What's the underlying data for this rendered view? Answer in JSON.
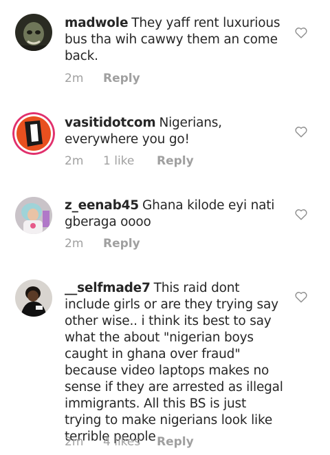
{
  "comments": [
    {
      "username": "madwole",
      "text": "They yaff rent luxurious bus tha wih cawwy them an come back.",
      "time": "2m",
      "likes": "",
      "reply": "Reply"
    },
    {
      "username": "vasitidotcom",
      "text": "Nigerians, everywhere you go!",
      "time": "2m",
      "likes": "1 like",
      "reply": "Reply"
    },
    {
      "username": "z_eenab45",
      "text": "Ghana kilode eyi nati gberaga oooo",
      "time": "2m",
      "likes": "",
      "reply": "Reply"
    },
    {
      "username": "__selfmade7",
      "text": "This raid dont include girls or are they trying say other wise.. i think its best to say what the about \"nigerian boys caught in ghana over fraud\"  because video laptops makes no sense if they are arrested as illegal immigrants. All this BS is just trying to make nigerians look like terrible people",
      "time": "2m",
      "likes": "4 likes",
      "reply": "Reply"
    }
  ],
  "icons": {
    "like": "heart-outline-icon"
  },
  "colors": {
    "text": "#262626",
    "meta": "#a0a0a0",
    "vasiti_ring": "#e1306c",
    "vasiti_accent": "#e8501f"
  }
}
